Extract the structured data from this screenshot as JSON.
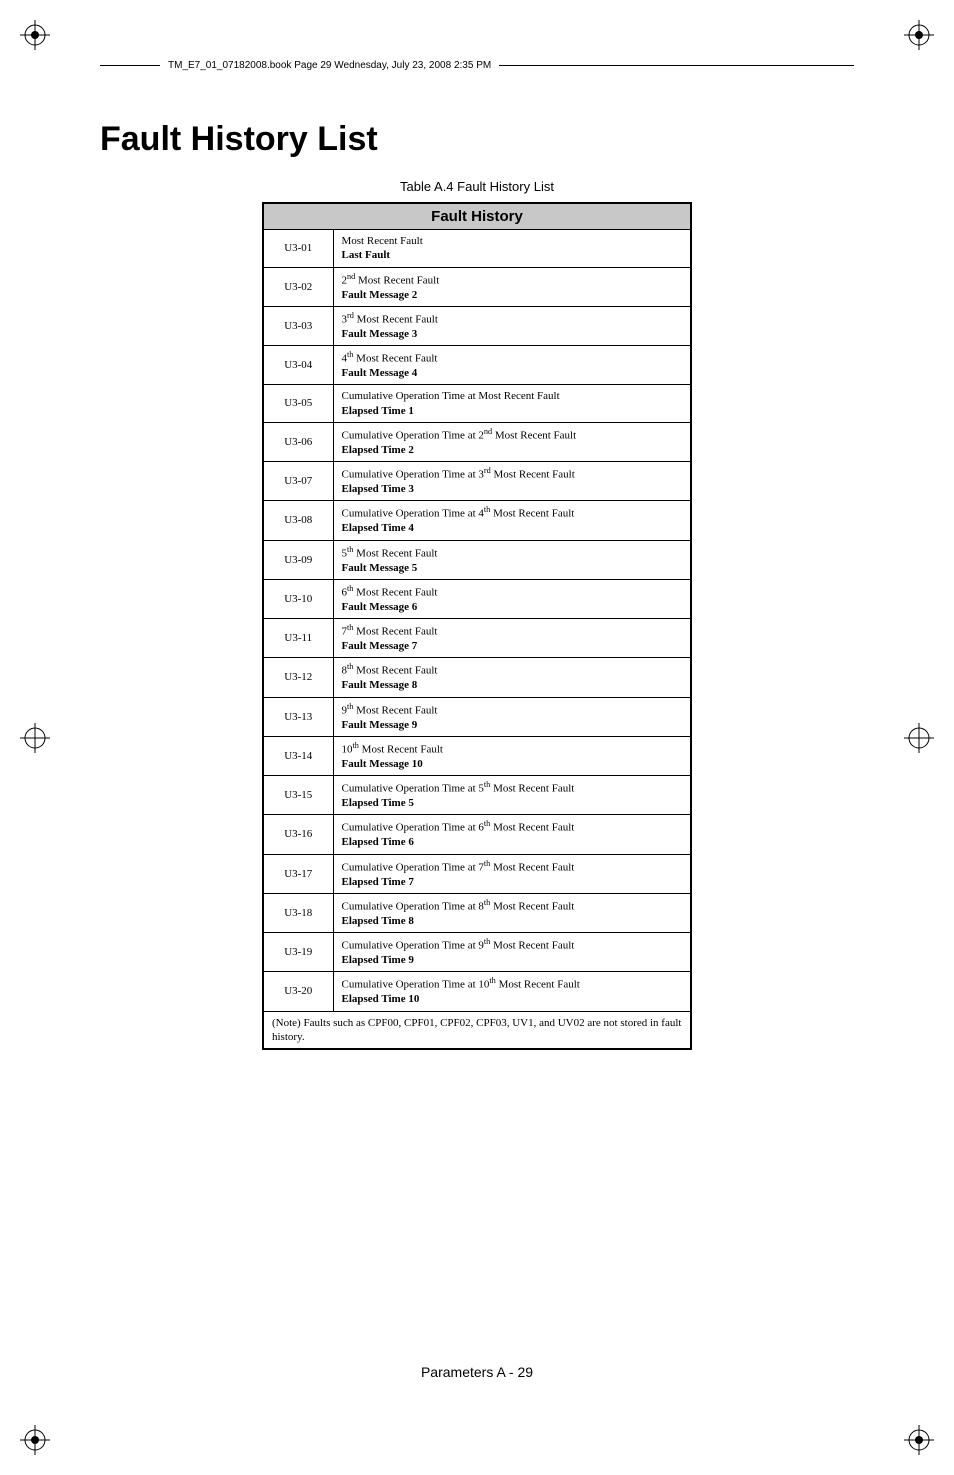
{
  "header_text": "TM_E7_01_07182008.book  Page 29  Wednesday, July 23, 2008  2:35 PM",
  "title": "Fault History List",
  "table_caption": "Table A.4  Fault History List",
  "table_header": "Fault History",
  "rows": [
    {
      "code": "U3-01",
      "line1": "Most Recent Fault",
      "line2": "Last Fault"
    },
    {
      "code": "U3-02",
      "line1": "2<sup>nd</sup> Most Recent Fault",
      "line2": "Fault Message 2"
    },
    {
      "code": "U3-03",
      "line1": "3<sup>rd</sup> Most Recent Fault",
      "line2": "Fault Message 3"
    },
    {
      "code": "U3-04",
      "line1": "4<sup>th</sup> Most Recent Fault",
      "line2": "Fault Message 4"
    },
    {
      "code": "U3-05",
      "line1": "Cumulative Operation Time at  Most Recent Fault",
      "line2": "Elapsed Time 1"
    },
    {
      "code": "U3-06",
      "line1": "Cumulative Operation Time at 2<sup>nd</sup>  Most Recent Fault",
      "line2": "Elapsed Time 2"
    },
    {
      "code": "U3-07",
      "line1": "Cumulative Operation Time at 3<sup>rd</sup>  Most Recent Fault",
      "line2": "Elapsed Time 3"
    },
    {
      "code": "U3-08",
      "line1": "Cumulative Operation Time at 4<sup>th</sup> Most Recent Fault",
      "line2": "Elapsed Time 4"
    },
    {
      "code": "U3-09",
      "line1": "5<sup>th</sup> Most Recent Fault",
      "line2": "Fault Message 5"
    },
    {
      "code": "U3-10",
      "line1": "6<sup>th</sup> Most Recent Fault",
      "line2": "Fault Message 6"
    },
    {
      "code": "U3-11",
      "line1": "7<sup>th</sup> Most Recent Fault",
      "line2": "Fault Message 7"
    },
    {
      "code": "U3-12",
      "line1": "8<sup>th</sup> Most Recent Fault",
      "line2": "Fault Message 8"
    },
    {
      "code": "U3-13",
      "line1": "9<sup>th</sup> Most Recent Fault",
      "line2": "Fault Message 9"
    },
    {
      "code": "U3-14",
      "line1": "10<sup>th</sup> Most Recent Fault",
      "line2": "Fault Message 10"
    },
    {
      "code": "U3-15",
      "line1": "Cumulative Operation Time at 5<sup>th</sup> Most Recent Fault",
      "line2": "Elapsed Time 5"
    },
    {
      "code": "U3-16",
      "line1": "Cumulative Operation Time at 6<sup>th</sup> Most Recent Fault",
      "line2": "Elapsed Time 6"
    },
    {
      "code": "U3-17",
      "line1": "Cumulative Operation Time at 7<sup>th</sup> Most Recent Fault",
      "line2": "Elapsed Time 7"
    },
    {
      "code": "U3-18",
      "line1": "Cumulative Operation Time at 8<sup>th</sup> Most Recent Fault",
      "line2": "Elapsed Time 8"
    },
    {
      "code": "U3-19",
      "line1": "Cumulative Operation Time at 9<sup>th</sup> Most Recent Fault",
      "line2": "Elapsed Time 9"
    },
    {
      "code": "U3-20",
      "line1": "Cumulative Operation Time at 10<sup>th</sup> Most Recent Fault",
      "line2": "Elapsed Time 10"
    }
  ],
  "note": "(Note) Faults such as CPF00, CPF01, CPF02, CPF03, UV1, and UV02 are not stored in fault history.",
  "footer": "Parameters  A - 29"
}
